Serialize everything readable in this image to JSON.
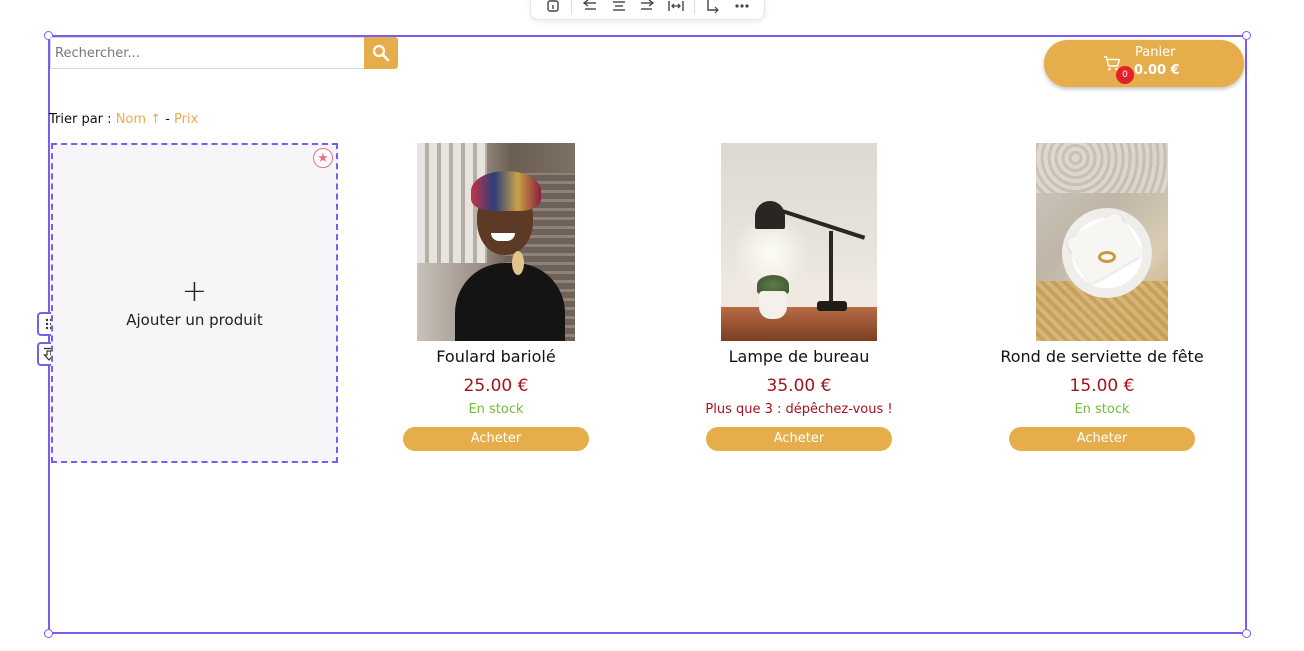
{
  "toolbar": {
    "buttons": [
      "info-icon",
      "align-left-icon",
      "align-center-icon",
      "align-right-icon",
      "stretch-icon",
      "resize-icon",
      "more-icon"
    ]
  },
  "search": {
    "placeholder": "Rechercher...",
    "value": ""
  },
  "cart": {
    "label": "Panier",
    "total": "0.00 €",
    "count": "0"
  },
  "sort": {
    "prefix": "Trier par :",
    "name_link": "Nom ↑",
    "separator": "-",
    "price_link": "Prix"
  },
  "add_product": {
    "plus": "+",
    "label": "Ajouter un produit"
  },
  "products": [
    {
      "name": "Foulard bariolé",
      "price": "25.00 €",
      "stock": "En stock",
      "stock_color": "#6fbf3a",
      "buy": "Acheter"
    },
    {
      "name": "Lampe de bureau",
      "price": "35.00 €",
      "stock": "Plus que 3 : dépêchez-vous !",
      "stock_color": "#a3131e",
      "buy": "Acheter"
    },
    {
      "name": "Rond de serviette de fête",
      "price": "15.00 €",
      "stock": "En stock",
      "stock_color": "#6fbf3a",
      "buy": "Acheter"
    }
  ],
  "colors": {
    "accent": "#e6ae4a",
    "selection": "#7b5cf0",
    "price": "#a3131e",
    "in_stock": "#6fbf3a",
    "badge": "#e5202b"
  }
}
